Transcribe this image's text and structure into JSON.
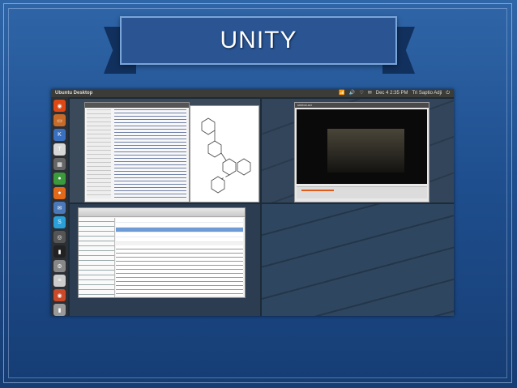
{
  "slide": {
    "title": "UNITY"
  },
  "desktop": {
    "panel_title": "Ubuntu Desktop",
    "indicators": [
      "📶",
      "🔊",
      "♡",
      "✉",
      "⏻"
    ],
    "clock": "Dec 4 2:35 PM",
    "user": "Tri Saptio Adji"
  },
  "launcher": {
    "items": [
      {
        "icon": "ubuntu-icon",
        "glyph": "◉",
        "color": "#dd4814"
      },
      {
        "icon": "home-folder-icon",
        "glyph": "▭",
        "color": "#c76b2a"
      },
      {
        "icon": "kde-icon",
        "glyph": "K",
        "color": "#3a70c0"
      },
      {
        "icon": "tex-icon",
        "glyph": "T",
        "color": "#d8d8d8"
      },
      {
        "icon": "grid-icon",
        "glyph": "▦",
        "color": "#666"
      },
      {
        "icon": "chrome-icon",
        "glyph": "●",
        "color": "#3b9a3b"
      },
      {
        "icon": "firefox-icon",
        "glyph": "●",
        "color": "#e06a1a"
      },
      {
        "icon": "mail-icon",
        "glyph": "✉",
        "color": "#4a78b8"
      },
      {
        "icon": "skype-icon",
        "glyph": "S",
        "color": "#2a9fd8"
      },
      {
        "icon": "camera-icon",
        "glyph": "◎",
        "color": "#555"
      },
      {
        "icon": "terminal-icon",
        "glyph": "▮",
        "color": "#222"
      },
      {
        "icon": "system-settings-icon",
        "glyph": "⚙",
        "color": "#888"
      },
      {
        "icon": "text-editor-icon",
        "glyph": "≡",
        "color": "#ccc"
      },
      {
        "icon": "ubuntu-one-icon",
        "glyph": "◉",
        "color": "#c94a2a"
      },
      {
        "icon": "trash-icon",
        "glyph": "▮",
        "color": "#999"
      }
    ]
  },
  "windows": {
    "player_title": "simbol.avi"
  },
  "colors": {
    "background": "#2a5592",
    "ribbon_border": "#7aa5d9"
  }
}
